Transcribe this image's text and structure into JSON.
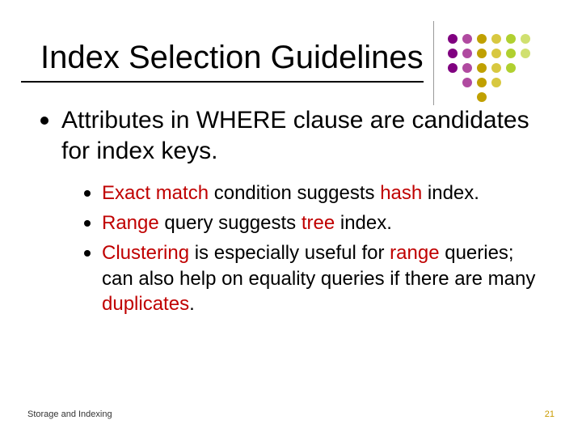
{
  "title": "Index Selection Guidelines",
  "main_bullet": "Attributes in WHERE clause are candidates for index keys.",
  "sub_bullets": [
    {
      "pre": "",
      "kw1": "Exact match",
      "mid": " condition suggests ",
      "kw2": "hash",
      "post": " index."
    },
    {
      "pre": "",
      "kw1": "Range",
      "mid": " query suggests ",
      "kw2": "tree",
      "post": " index."
    },
    {
      "pre": "",
      "kw1": "Clustering",
      "mid": " is especially useful for ",
      "kw2": "range",
      "post": " queries; can also help on equality queries if there are many ",
      "kw3": "duplicates",
      "tail": "."
    }
  ],
  "footer": {
    "left": "Storage and Indexing",
    "page": "21"
  },
  "deco_colors": {
    "col1": "#800080",
    "col2": "#b04aa0",
    "col3": "#c0a000",
    "col4": "#d8c840",
    "col5": "#b0d030",
    "col6": "#d0e070"
  }
}
